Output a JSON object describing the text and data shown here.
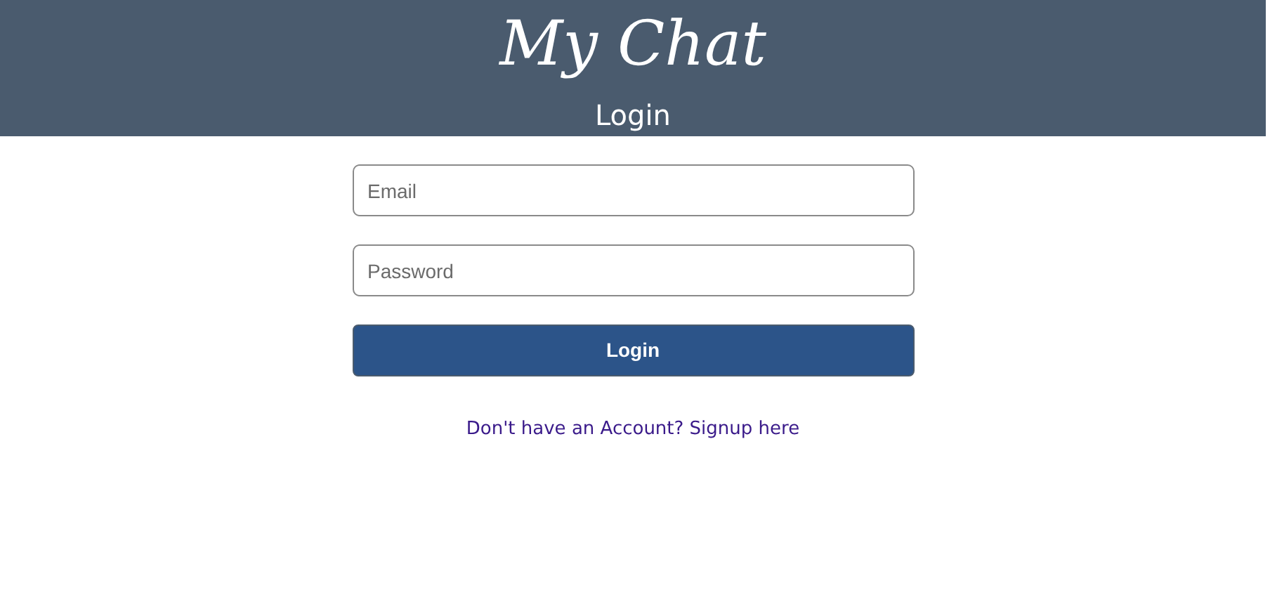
{
  "header": {
    "logo": "My Chat",
    "title": "Login"
  },
  "form": {
    "fields": [
      {
        "placeholder": "Email"
      },
      {
        "placeholder": "Password"
      }
    ],
    "submit": "Login"
  },
  "signup_link": "Don't have an Account? Signup here"
}
